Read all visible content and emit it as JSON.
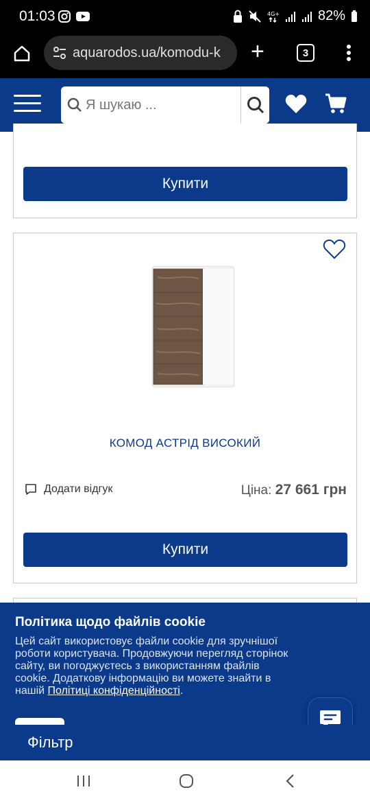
{
  "status_bar": {
    "time": "01:03",
    "battery": "82%",
    "icons": [
      "instagram-icon",
      "youtube-icon",
      "lock-icon",
      "mute-icon",
      "4g-icon",
      "signal-icon",
      "signal-icon",
      "battery-icon"
    ]
  },
  "browser": {
    "url": "aquarodos.ua/komodu-k",
    "tab_count": "3"
  },
  "site_header": {
    "search_placeholder": "Я шукаю ..."
  },
  "previous_card": {
    "buy_label": "Купити"
  },
  "product": {
    "name": "КОМОД АСТРІД ВИСОКИЙ",
    "review_label": "Додати відгук",
    "price_label": "Ціна:",
    "price_value": "27 661 грн",
    "buy_label": "Купити"
  },
  "cookie": {
    "title": "Політика щодо файлів cookie",
    "text": "Цей сайт використовує файли cookie для зручнішої роботи користувача. Продовжуючи перегляд сторінок сайту, ви погоджуєтесь з використанням файлів cookie. Додаткову інформацію ви можете знайти в нашій ",
    "link": "Політиці конфіденційності",
    "text_end": "."
  },
  "filter": {
    "label": "Фільтр"
  },
  "colors": {
    "brand": "#0b3a8a",
    "accent_text": "#0b3a8a"
  }
}
